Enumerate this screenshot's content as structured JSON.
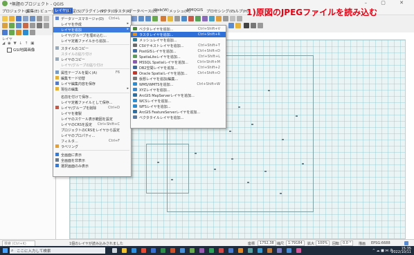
{
  "window": {
    "title": "*無題のプロジェクト - QGIS",
    "controls": "–  ▢  ✕"
  },
  "menubar": [
    "プロジェクト(J)",
    "編集(E)",
    "ビュー(V)",
    "レイヤ(L)",
    "設定(S)",
    "プラグイン(P)",
    "ベクタ(O)",
    "ラスタ(R)",
    "データベース(D)",
    "Web(W)",
    "メッシュ(M)",
    "MMQGIS",
    "プロセシング(C)",
    "ヘルプ(H)"
  ],
  "menubar_active_index": 3,
  "callout": "1)原図のJPEGファイルを読み込む",
  "layers_panel": {
    "title": "レイヤ",
    "tools": "◢ ◉ ▼ ↓ ↑ ▣",
    "layer_name": "GSI地図画像"
  },
  "layer_menu": {
    "items": [
      {
        "label": "データソースマネージャ(D)",
        "shortcut": "Ctrl+L",
        "icon": "data-source-icon"
      },
      {
        "label": "レイヤを作成",
        "arrow": "▸",
        "icon": "blank"
      },
      {
        "label": "レイヤを追加",
        "arrow": "▸",
        "icon": "blank",
        "highlight": true
      },
      {
        "label": "レイヤ/グループを埋め込む...",
        "icon": "blank"
      },
      {
        "label": "レイヤ定義ファイルから追加...",
        "icon": "blank"
      },
      {
        "label": "スタイルのコピー",
        "icon": "copy-icon"
      },
      {
        "label": "スタイルの貼り付け",
        "icon": "blank",
        "dim": true
      },
      {
        "label": "レイヤのコピー",
        "icon": "copy-icon"
      },
      {
        "label": "レイヤ/グループの貼り付け",
        "icon": "blank",
        "dim": true
      },
      {
        "label": "属性テーブルを開く(A)",
        "shortcut": "F6",
        "icon": "table-icon"
      },
      {
        "label": "編集モード切替",
        "icon": "pencil-icon"
      },
      {
        "label": "レイヤ編集内容を保存",
        "icon": "save-icon"
      },
      {
        "label": "現在の編集",
        "arrow": "▸",
        "icon": "pencil-icon"
      },
      {
        "label": "名前を付けて保存...",
        "icon": "blank"
      },
      {
        "label": "レイヤ定義ファイルとして保存...",
        "icon": "blank"
      },
      {
        "label": "レイヤ/グループを削除",
        "shortcut": "Ctrl+D",
        "icon": "remove-icon"
      },
      {
        "label": "レイヤを複製",
        "icon": "blank"
      },
      {
        "label": "レイヤのスケール表示範囲を設定",
        "icon": "blank"
      },
      {
        "label": "レイヤのCRSを設定",
        "shortcut": "Ctrl+Shift+C",
        "icon": "blank"
      },
      {
        "label": "プロジェクトのCRSをレイヤから設定",
        "icon": "blank"
      },
      {
        "label": "レイヤのプロパティ...",
        "icon": "blank"
      },
      {
        "label": "フィルタ...",
        "shortcut": "Ctrl+F",
        "icon": "blank"
      },
      {
        "label": "ラベリング",
        "icon": "label-icon"
      },
      {
        "label": "全画面に表示",
        "icon": "show-icon"
      },
      {
        "label": "全画面を非表示",
        "icon": "hide-icon"
      },
      {
        "label": "選択画面のみ表示",
        "icon": "show-icon"
      }
    ]
  },
  "add_layer_submenu": {
    "items": [
      {
        "label": "ベクタレイヤを追加...",
        "shortcut": "Ctrl+Shift+V",
        "color": "#4a8a3c"
      },
      {
        "label": "ラスタレイヤを追加...",
        "shortcut": "Ctrl+Shift+R",
        "color": "#d98c2a",
        "highlight": true
      },
      {
        "label": "メッシュレイヤを追加...",
        "color": "#2a7a9a"
      },
      {
        "label": "CSVテキストレイヤを追加...",
        "shortcut": "Ctrl+Shift+T",
        "color": "#6a6a6a"
      },
      {
        "label": "PostGISレイヤを追加...",
        "shortcut": "Ctrl+Shift+D",
        "color": "#3e6ea8"
      },
      {
        "label": "SpatiaLiteレイヤを追加...",
        "shortcut": "Ctrl+Shift+L",
        "color": "#5a9a5a"
      },
      {
        "label": "MSSQL Spatialレイヤを追加...",
        "shortcut": "Ctrl+Shift+M",
        "color": "#8a5ab0"
      },
      {
        "label": "DB2空間レイヤを追加...",
        "shortcut": "Ctrl+Shift+2",
        "color": "#3a6a9a"
      },
      {
        "label": "Oracle Spatialレイヤを追加...",
        "shortcut": "Ctrl+Shift+O",
        "color": "#c0392b"
      },
      {
        "label": "仮想レイヤを追加/編集...",
        "color": "#7a7a7a"
      },
      {
        "label": "WMS/WMTSを追加...",
        "shortcut": "Ctrl+Shift+W",
        "color": "#2d8bd0"
      },
      {
        "label": "XYZレイヤを追加...",
        "color": "#3a8ad0"
      },
      {
        "label": "ArcGIS MapServerレイヤを追加...",
        "color": "#2e6ea0"
      },
      {
        "label": "WCSレイヤを追加...",
        "color": "#2d8bd0"
      },
      {
        "label": "WFSレイヤを追加...",
        "color": "#2d8bd0"
      },
      {
        "label": "ArcGIS FeatureServerレイヤを追加...",
        "color": "#2e6ea0"
      },
      {
        "label": "ベクタタイルレイヤを追加...",
        "color": "#5a7aa0"
      }
    ]
  },
  "statusbar": {
    "locator": "検索 (Ctrl+K)",
    "message": "1個のレイヤが読み込みされました",
    "coord_label": "座標",
    "coordinate": "1752,38",
    "scale_label": "縮尺",
    "scale": "1:79184",
    "magnifier_label": "拡大",
    "magnifier": "100%",
    "rotation_label": "回転",
    "rotation": "0.0 °",
    "render_label": "描画",
    "crs": "EPSG:6688"
  },
  "taskbar": {
    "search_placeholder": "ここに入力して検索",
    "tray": "^ ☁ ■ ⋈ あ",
    "time": "15:35",
    "date": "2022/10/11"
  }
}
